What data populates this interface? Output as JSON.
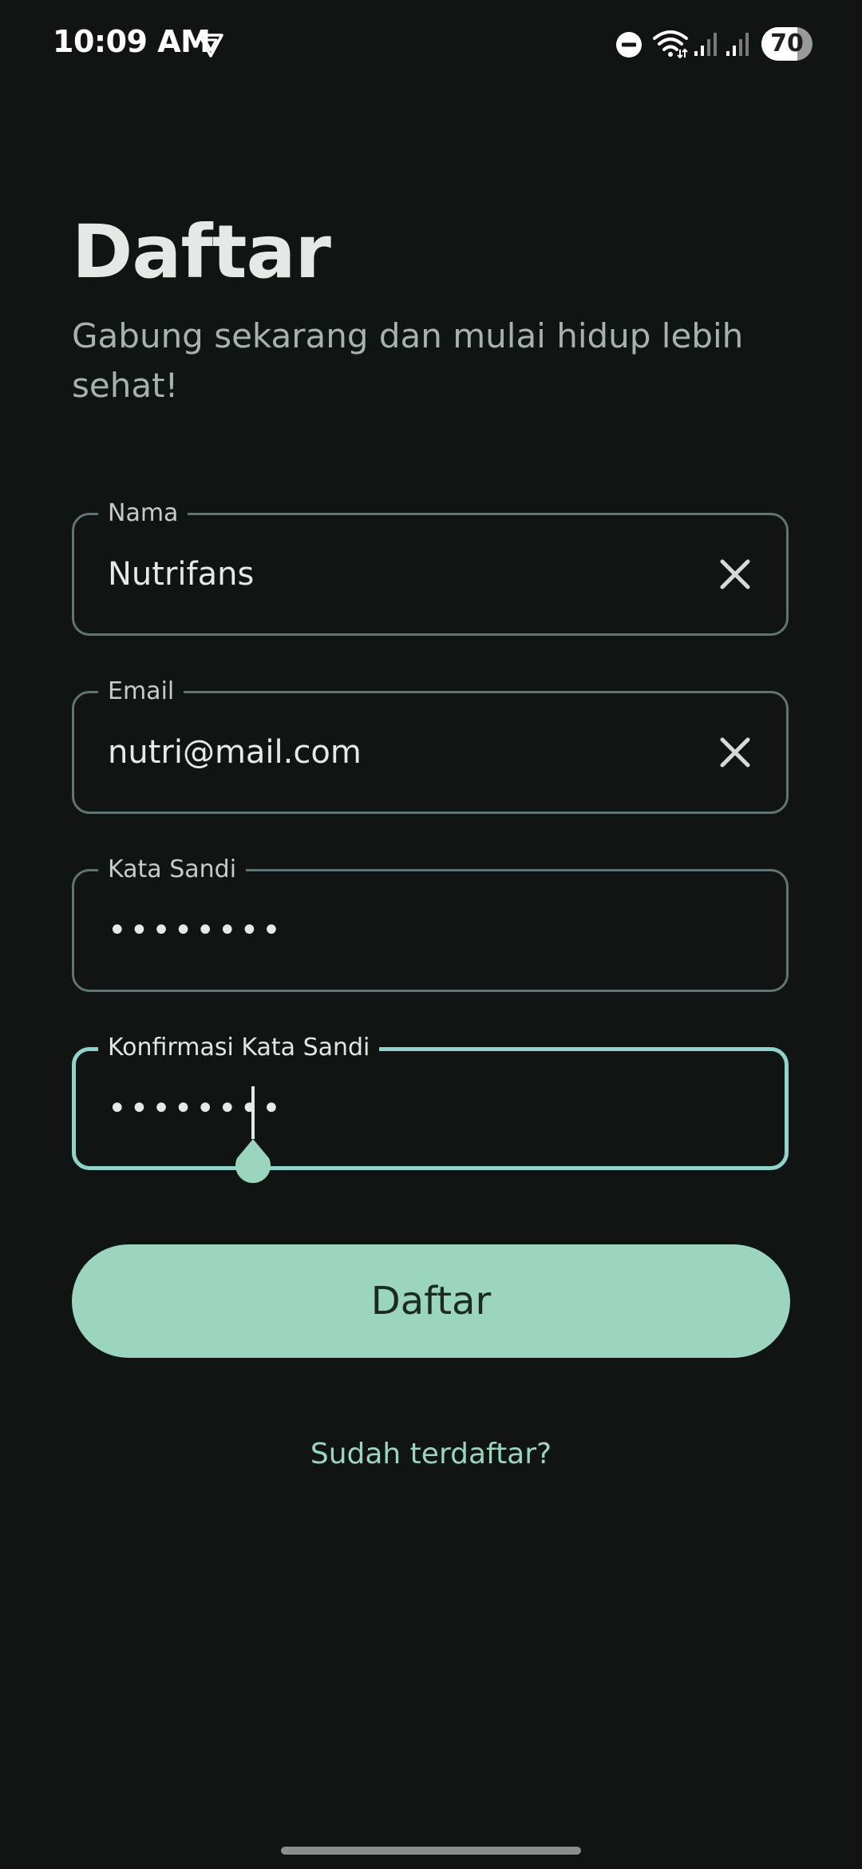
{
  "status_bar": {
    "time": "10:09 AM",
    "battery": "70",
    "battery_level": 0.7,
    "icons": [
      "vpn-icon",
      "do-not-disturb-icon",
      "wifi-icon",
      "signal-icon",
      "signal-icon"
    ]
  },
  "header": {
    "title": "Daftar",
    "subtitle": "Gabung sekarang dan mulai hidup lebih sehat!"
  },
  "form": {
    "name": {
      "label": "Nama",
      "value": "Nutrifans"
    },
    "email": {
      "label": "Email",
      "value": "nutri@mail.com"
    },
    "password": {
      "label": "Kata Sandi",
      "value": "••••••••"
    },
    "confirm_password": {
      "label": "Konfirmasi Kata Sandi",
      "value": "••••••••"
    }
  },
  "actions": {
    "submit_label": "Daftar",
    "login_link": "Sudah terdaftar?"
  },
  "colors": {
    "background": "#101412",
    "accent": "#9bd5bd",
    "focus_border": "#8fd3cb",
    "field_border": "#5f7473"
  }
}
